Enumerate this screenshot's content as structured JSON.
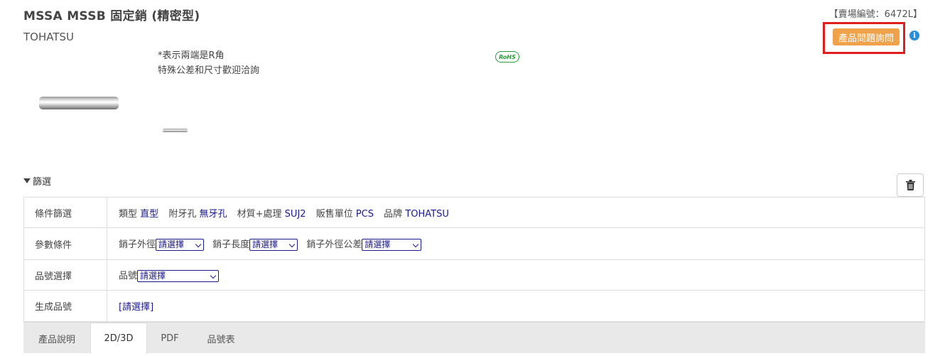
{
  "header": {
    "title": "MSSA MSSB 固定銷 (精密型)",
    "brand": "TOHATSU",
    "store_code": "【賣場編號：6472L】",
    "inquiry_button": "產品問題詢問",
    "info_icon_glyph": "i"
  },
  "notes": [
    "*表示兩端是R角",
    "特殊公差和尺寸歡迎洽詢"
  ],
  "rohs_label": "RoHS",
  "filter": {
    "toggle_label": "篩選",
    "rows": {
      "conditions": {
        "label": "條件篩選",
        "items": [
          {
            "key": "類型",
            "value": "直型"
          },
          {
            "key": "附牙孔",
            "value": "無牙孔"
          },
          {
            "key": "材質+處理",
            "value": "SUJ2"
          },
          {
            "key": "販售單位",
            "value": "PCS"
          },
          {
            "key": "品牌",
            "value": "TOHATSU"
          }
        ]
      },
      "params": {
        "label": "參數條件",
        "fields": [
          {
            "label": "銷子外徑",
            "value": "請選擇"
          },
          {
            "label": "銷子長度",
            "value": "請選擇"
          },
          {
            "label": "銷子外徑公差",
            "value": "請選擇"
          }
        ]
      },
      "part": {
        "label": "品號選擇",
        "field_label": "品號",
        "value": "請選擇"
      },
      "generated": {
        "label": "生成品號",
        "value": "[請選擇]"
      }
    }
  },
  "tabs": [
    "產品說明",
    "2D/3D",
    "PDF",
    "品號表"
  ],
  "active_tab": "2D/3D",
  "colors": {
    "inquiry_button": "#f0a24a",
    "highlight": "#e01e1e",
    "value_text": "#1a1a8c",
    "rohs": "#2a9a3a",
    "info": "#2a8fd6"
  }
}
